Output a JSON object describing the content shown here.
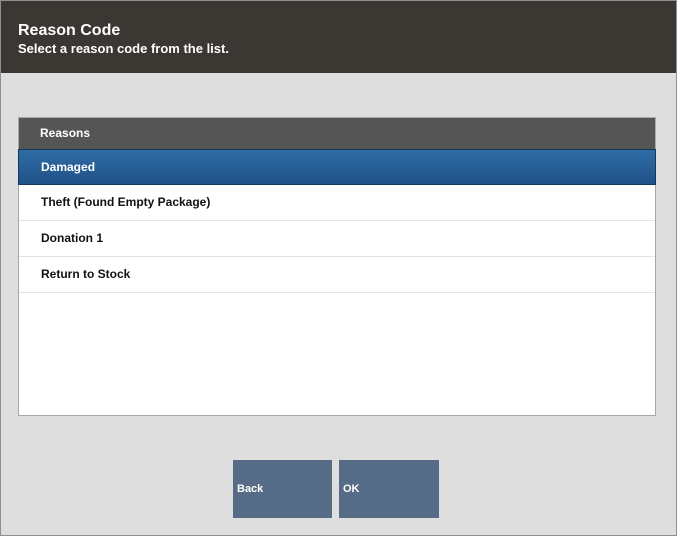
{
  "header": {
    "title": "Reason Code",
    "subtitle": "Select a reason code from the list."
  },
  "list": {
    "header": "Reasons",
    "items": [
      {
        "label": "Damaged",
        "selected": true
      },
      {
        "label": "Theft (Found Empty Package)",
        "selected": false
      },
      {
        "label": "Donation 1",
        "selected": false
      },
      {
        "label": "Return to Stock",
        "selected": false
      }
    ]
  },
  "buttons": {
    "back_label": "Back",
    "ok_label": "OK"
  },
  "colors": {
    "header_bg": "#3b3834",
    "selected_row": "#2f6da5",
    "button_bg": "#566b85"
  }
}
